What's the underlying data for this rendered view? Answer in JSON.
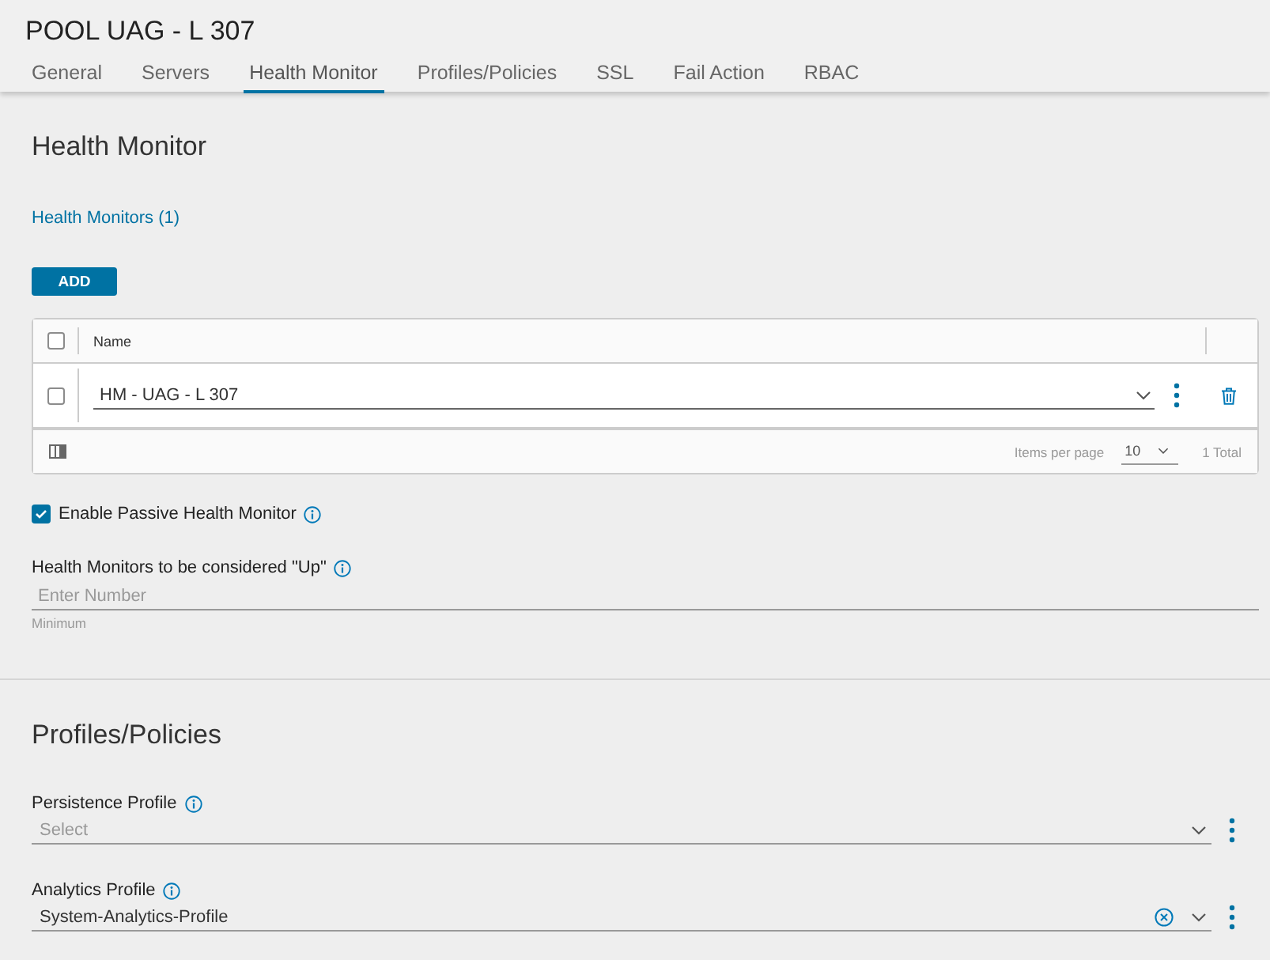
{
  "header": {
    "title": "POOL UAG - L 307"
  },
  "tabs": [
    {
      "label": "General",
      "selected": false
    },
    {
      "label": "Servers",
      "selected": false
    },
    {
      "label": "Health Monitor",
      "selected": true
    },
    {
      "label": "Profiles/Policies",
      "selected": false
    },
    {
      "label": "SSL",
      "selected": false
    },
    {
      "label": "Fail Action",
      "selected": false
    },
    {
      "label": "RBAC",
      "selected": false
    }
  ],
  "health_monitor": {
    "title": "Health Monitor",
    "link": "Health Monitors (1)",
    "add_button": "ADD",
    "grid": {
      "select_all_checked": false,
      "columns": [
        "Name"
      ],
      "rows": [
        {
          "checked": false,
          "value": "HM - UAG - L 307"
        }
      ],
      "footer": {
        "items_per_page_label": "Items per page",
        "page_size": "10",
        "total": "1 Total"
      }
    },
    "passive": {
      "label": "Enable Passive Health Monitor",
      "checked": true
    },
    "up_field": {
      "label": "Health Monitors to be considered \"Up\"",
      "placeholder": "Enter Number",
      "helper": "Minimum"
    }
  },
  "profiles": {
    "title": "Profiles/Policies",
    "fields": [
      {
        "label": "Persistence Profile",
        "placeholder": "Select",
        "clearable": false
      },
      {
        "label": "Analytics Profile",
        "value": "System-Analytics-Profile",
        "clearable": true
      }
    ]
  }
}
